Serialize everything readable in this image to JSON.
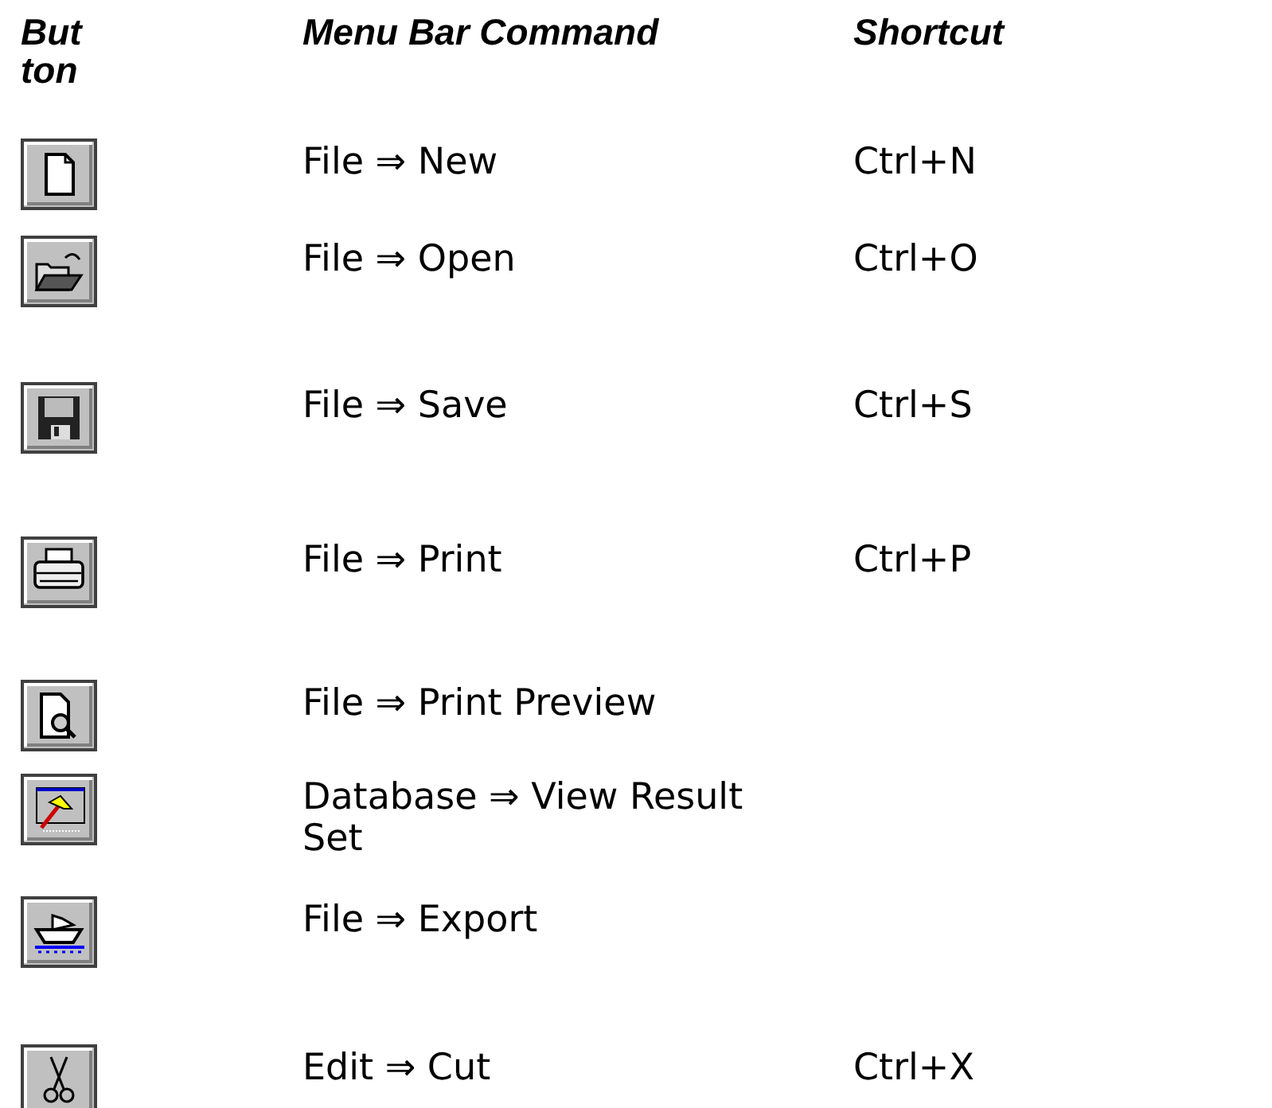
{
  "headers": {
    "button": "Button",
    "command": "Menu Bar Command",
    "shortcut": "Shortcut"
  },
  "rows": [
    {
      "kind": "new",
      "command": "File ⇒ New",
      "shortcut": "Ctrl+N"
    },
    {
      "kind": "open",
      "command": "File ⇒ Open",
      "shortcut": "Ctrl+O"
    },
    {
      "kind": "save",
      "command": "File ⇒ Save",
      "shortcut": "Ctrl+S"
    },
    {
      "kind": "print",
      "command": "File ⇒ Print",
      "shortcut": "Ctrl+P"
    },
    {
      "kind": "preview",
      "command": "File ⇒ Print Preview"
    },
    {
      "kind": "result",
      "command": "Database ⇒ View Result Set"
    },
    {
      "kind": "export",
      "command": "File ⇒ Export"
    },
    {
      "kind": "cut",
      "command": "Edit ⇒ Cut",
      "shortcut": "Ctrl+X"
    }
  ]
}
